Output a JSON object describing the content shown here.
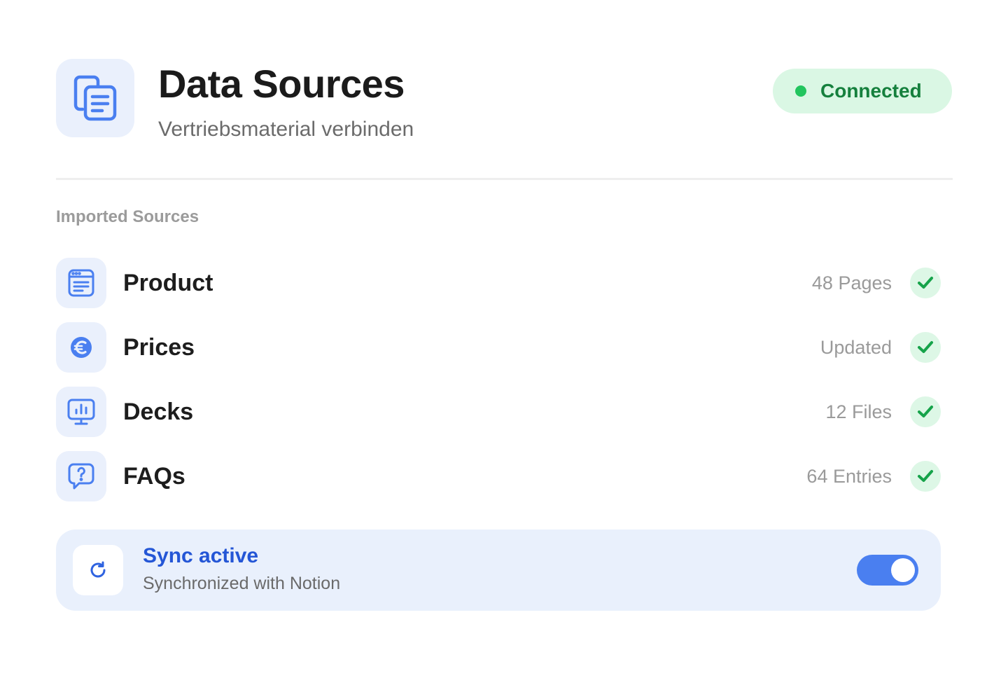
{
  "header": {
    "title": "Data Sources",
    "subtitle": "Vertriebsmaterial verbinden",
    "icon": "documents-icon",
    "status": {
      "label": "Connected",
      "color": "#22c55e"
    }
  },
  "section": {
    "label": "Imported Sources"
  },
  "sources": [
    {
      "name": "Product",
      "meta": "48 Pages",
      "icon": "browser-page-icon",
      "status": "check"
    },
    {
      "name": "Prices",
      "meta": "Updated",
      "icon": "euro-icon",
      "status": "check"
    },
    {
      "name": "Decks",
      "meta": "12 Files",
      "icon": "presentation-chart-icon",
      "status": "check"
    },
    {
      "name": "FAQs",
      "meta": "64 Entries",
      "icon": "question-chat-icon",
      "status": "check"
    }
  ],
  "sync": {
    "title": "Sync active",
    "subtitle": "Synchronized with Notion",
    "icon": "refresh-icon",
    "enabled": true
  },
  "colors": {
    "accent": "#4a7ff0",
    "accent_text": "#2456d6",
    "success": "#22c55e",
    "success_text": "#15803d",
    "tile_background": "#eaf0fc"
  }
}
